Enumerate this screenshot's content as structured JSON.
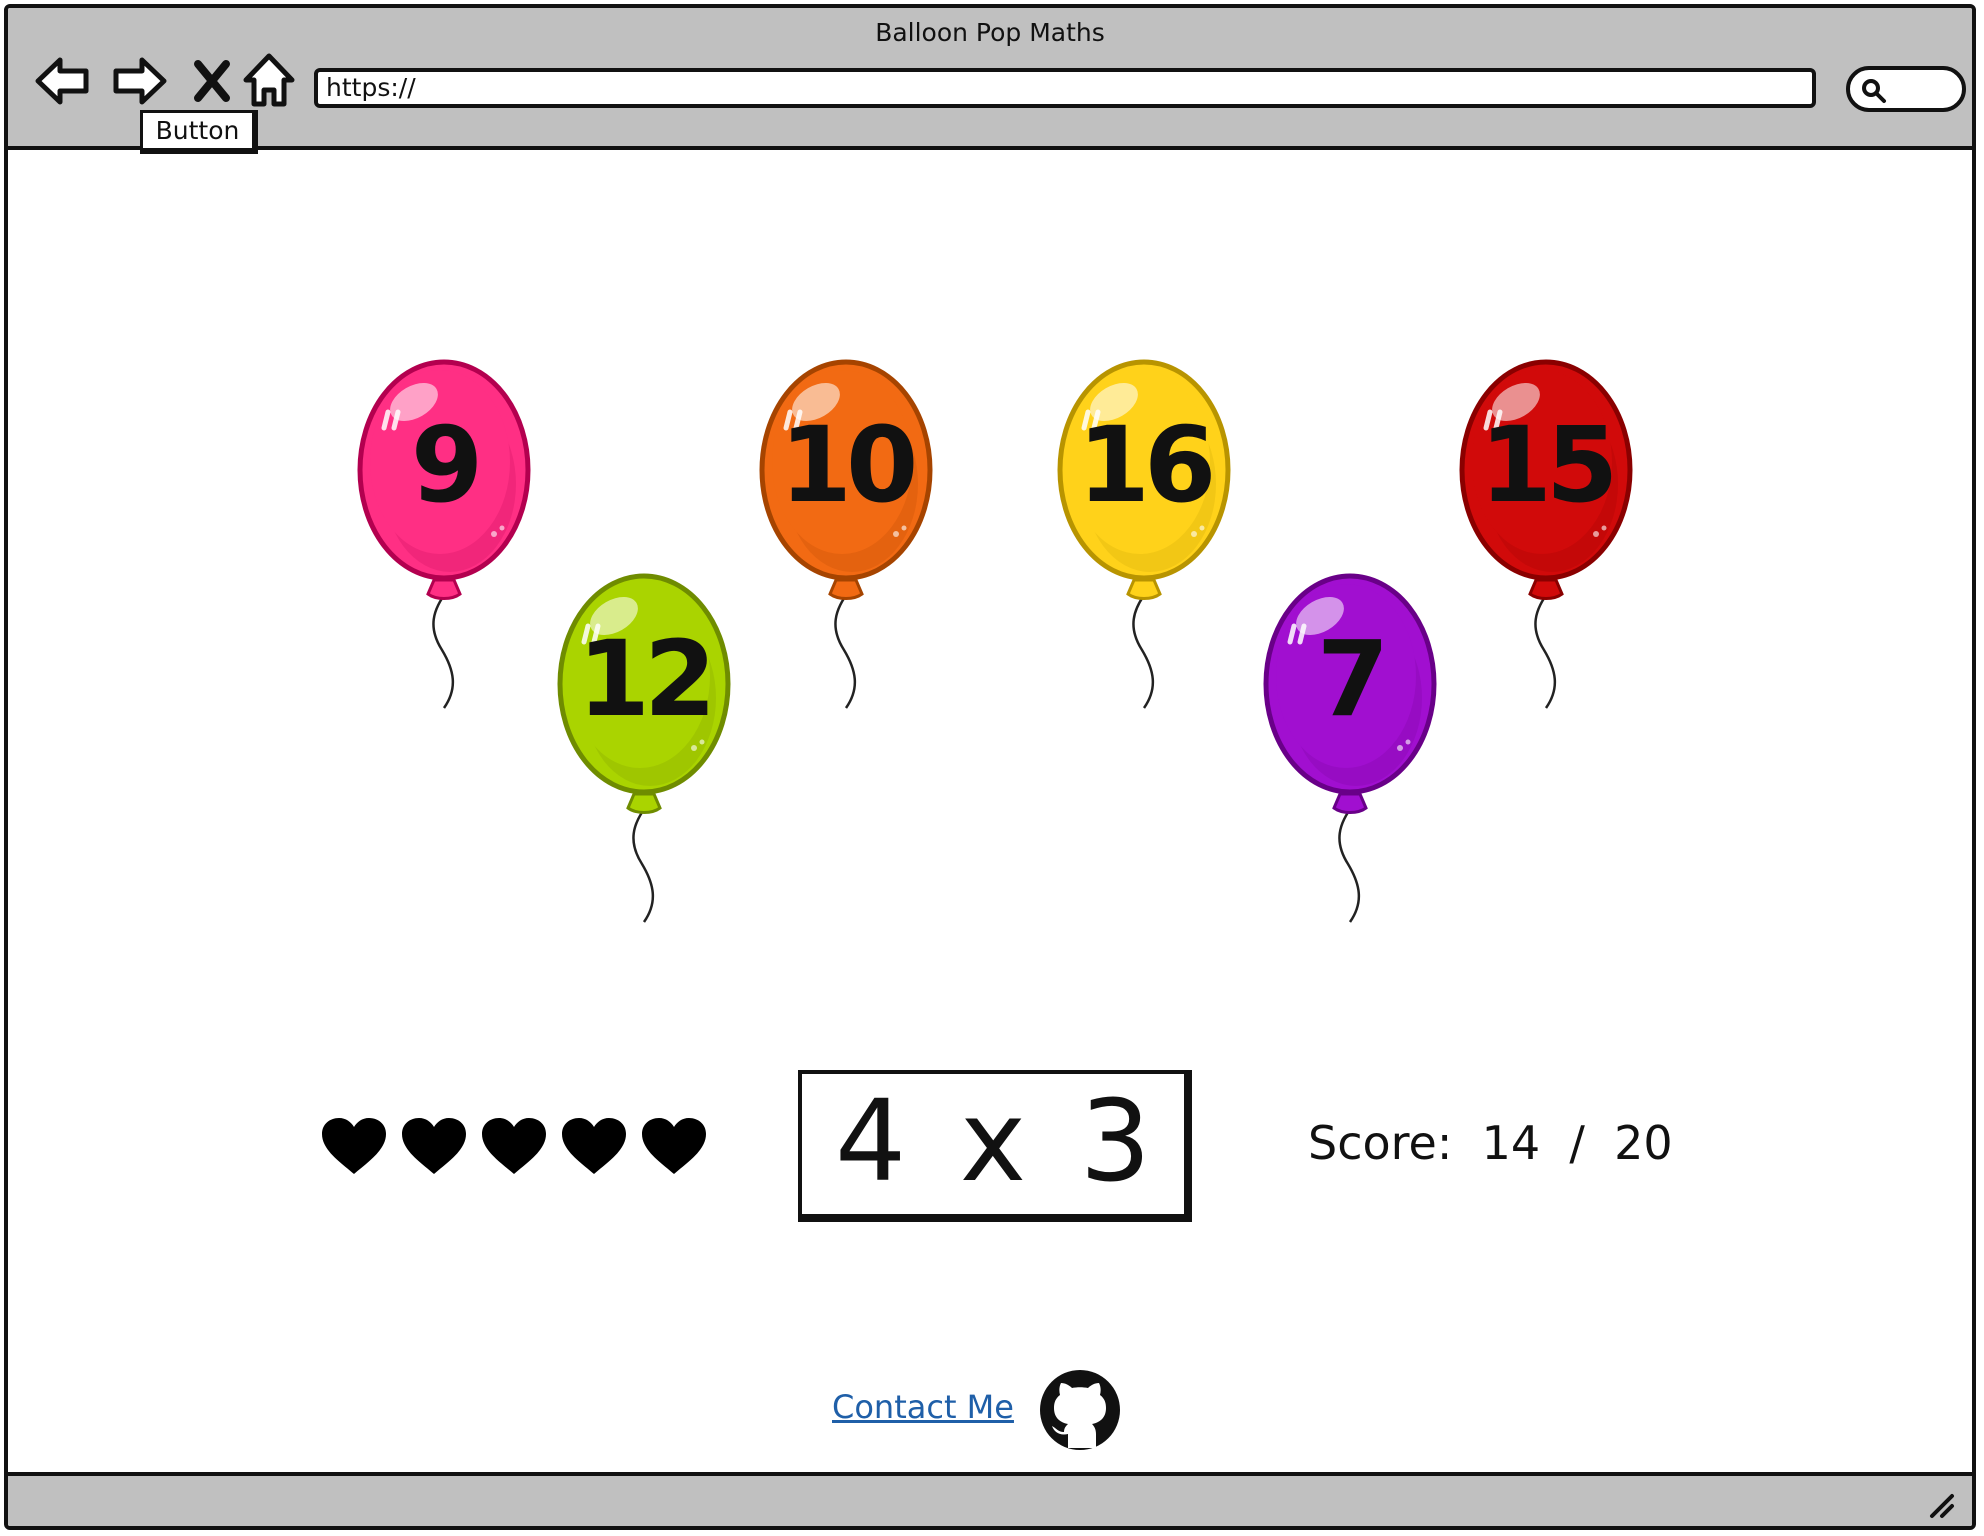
{
  "window": {
    "title": "Balloon Pop Maths"
  },
  "toolbar": {
    "url": "https://",
    "tooltip_button_label": "Button"
  },
  "balloons": [
    {
      "number": "9",
      "color": "#ff2f84",
      "dark": "#b3004f",
      "icon": "balloon-icon"
    },
    {
      "number": "12",
      "color": "#aad400",
      "dark": "#6f8c00",
      "icon": "balloon-icon"
    },
    {
      "number": "10",
      "color": "#f26a13",
      "dark": "#a64400",
      "icon": "balloon-icon"
    },
    {
      "number": "16",
      "color": "#ffd21a",
      "dark": "#b89400",
      "icon": "balloon-icon"
    },
    {
      "number": "7",
      "color": "#a10fd0",
      "dark": "#690088",
      "icon": "balloon-icon"
    },
    {
      "number": "15",
      "color": "#d10a0a",
      "dark": "#8a0000",
      "icon": "balloon-icon"
    }
  ],
  "game": {
    "lives": 5,
    "question": "4 x 3",
    "score_label": "Score:",
    "score": "14",
    "score_separator": "/",
    "score_total": "20"
  },
  "footer": {
    "contact_label": "Contact Me",
    "github_icon": "github-icon"
  }
}
